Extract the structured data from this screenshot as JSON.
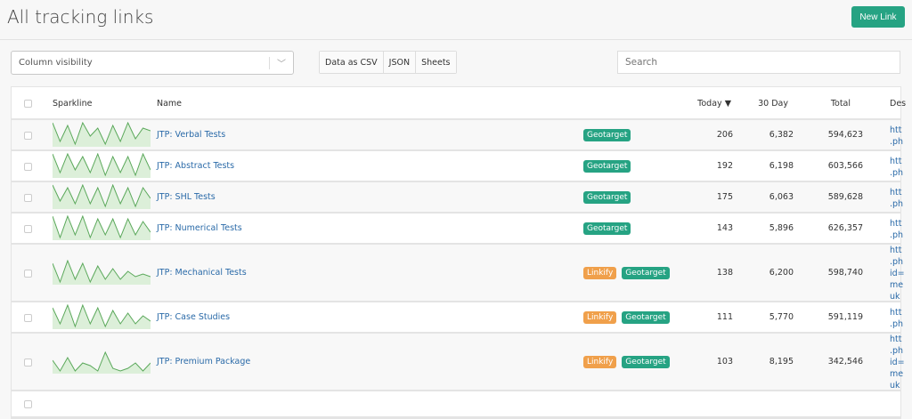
{
  "page": {
    "title": "All tracking links",
    "new_link": "New Link"
  },
  "controls": {
    "column_visibility": "Column visibility",
    "export": [
      "Data as CSV",
      "JSON",
      "Sheets"
    ],
    "search_placeholder": "Search"
  },
  "columns": {
    "sparkline": "Sparkline",
    "name": "Name",
    "today": "Today",
    "sort_indicator": "▼",
    "d30": "30 Day",
    "total": "Total",
    "dest": "Des"
  },
  "colors": {
    "geotarget": "#26a383",
    "linkify": "#f0a04b",
    "link": "#2a6aa8",
    "spark": "#5aa85a"
  },
  "rows": [
    {
      "name": "JTP: Verbal Tests",
      "badges": [
        "Geotarget"
      ],
      "today": "206",
      "d30": "6,382",
      "total": "594,623",
      "dest": [
        "htt",
        ".ph"
      ],
      "spark": [
        9,
        2,
        8,
        1,
        9,
        4,
        7,
        1,
        8,
        2,
        9,
        3,
        7,
        6
      ]
    },
    {
      "name": "JTP: Abstract Tests",
      "badges": [
        "Geotarget"
      ],
      "today": "192",
      "d30": "6,198",
      "total": "603,566",
      "dest": [
        "htt",
        ".ph"
      ],
      "spark": [
        9,
        2,
        9,
        3,
        8,
        2,
        9,
        1,
        8,
        2,
        8,
        1,
        9,
        3
      ]
    },
    {
      "name": "JTP: SHL Tests",
      "badges": [
        "Geotarget"
      ],
      "today": "175",
      "d30": "6,063",
      "total": "589,628",
      "dest": [
        "htt",
        ".ph"
      ],
      "spark": [
        9,
        3,
        8,
        2,
        9,
        2,
        8,
        1,
        9,
        2,
        8,
        1,
        8,
        4
      ]
    },
    {
      "name": "JTP: Numerical Tests",
      "badges": [
        "Geotarget"
      ],
      "today": "143",
      "d30": "5,896",
      "total": "626,357",
      "dest": [
        "htt",
        ".ph"
      ],
      "spark": [
        9,
        1,
        9,
        2,
        9,
        1,
        8,
        2,
        8,
        1,
        8,
        2,
        7,
        3
      ]
    },
    {
      "name": "JTP: Mechanical Tests",
      "badges": [
        "Linkify",
        "Geotarget"
      ],
      "today": "138",
      "d30": "6,200",
      "total": "598,740",
      "dest": [
        "htt",
        ".ph",
        "id=",
        "me",
        "uk"
      ],
      "spark": [
        8,
        1,
        9,
        2,
        8,
        1,
        7,
        2,
        6,
        2,
        5,
        3,
        4,
        3
      ]
    },
    {
      "name": "JTP: Case Studies",
      "badges": [
        "Linkify",
        "Geotarget"
      ],
      "today": "111",
      "d30": "5,770",
      "total": "591,119",
      "dest": [
        "htt",
        ".ph"
      ],
      "spark": [
        8,
        2,
        9,
        1,
        9,
        2,
        8,
        1,
        7,
        2,
        6,
        2,
        5,
        3
      ]
    },
    {
      "name": "JTP: Premium Package",
      "badges": [
        "Linkify",
        "Geotarget"
      ],
      "today": "103",
      "d30": "8,195",
      "total": "342,546",
      "dest": [
        "htt",
        ".ph",
        "id=",
        "me",
        "uk"
      ],
      "spark": [
        5,
        1,
        6,
        1,
        4,
        3,
        1,
        8,
        2,
        1,
        2,
        4,
        1,
        4
      ]
    }
  ]
}
